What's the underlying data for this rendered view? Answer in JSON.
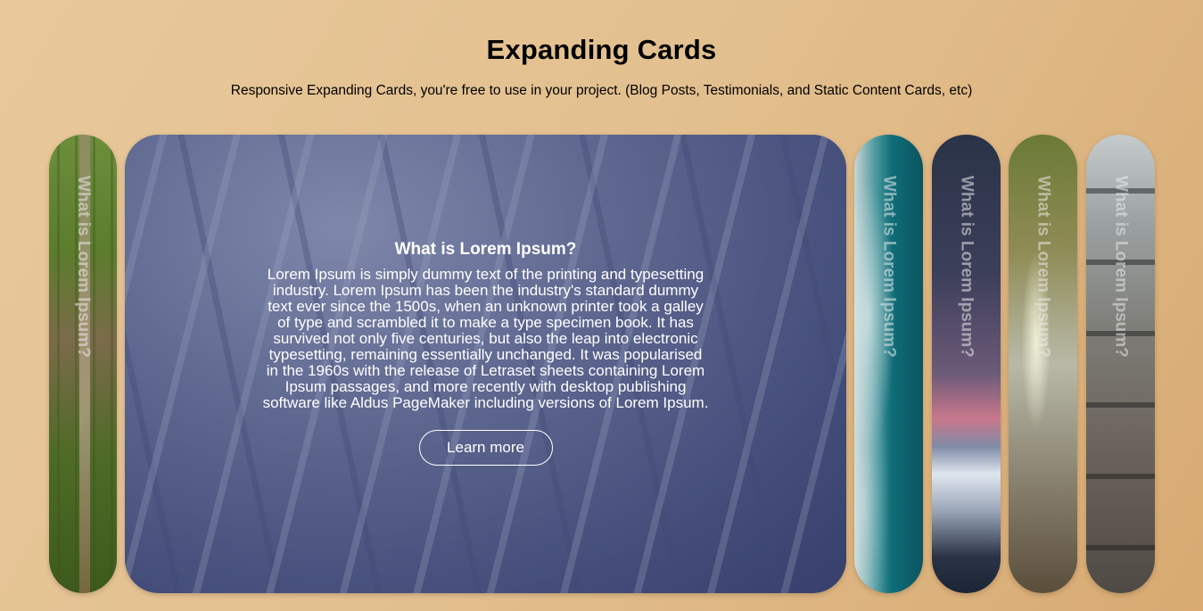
{
  "header": {
    "title": "Expanding Cards",
    "subtitle": "Responsive Expanding Cards, you're free to use in your project. (Blog Posts, Testimonials, and Static Content Cards, etc)"
  },
  "cards": [
    {
      "label": "What is Lorem Ipsum?",
      "image": "forest-image"
    },
    {
      "label": "What is Lorem Ipsum?",
      "image": "snowy-forest-image",
      "active": true,
      "heading": "What is Lorem Ipsum?",
      "body": "Lorem Ipsum is simply dummy text of the printing and typesetting industry. Lorem Ipsum has been the industry's standard dummy text ever since the 1500s, when an unknown printer took a galley of type and scrambled it to make a type specimen book. It has survived not only five centuries, but also the leap into electronic typesetting, remaining essentially unchanged. It was popularised in the 1960s with the release of Letraset sheets containing Lorem Ipsum passages, and more recently with desktop publishing software like Aldus PageMaker including versions of Lorem Ipsum.",
      "button": "Learn more"
    },
    {
      "label": "What is Lorem Ipsum?",
      "image": "ocean-image"
    },
    {
      "label": "What is Lorem Ipsum?",
      "image": "mountain-sunset-image"
    },
    {
      "label": "What is Lorem Ipsum?",
      "image": "tree-image"
    },
    {
      "label": "What is Lorem Ipsum?",
      "image": "stacked-stones-image"
    }
  ]
}
